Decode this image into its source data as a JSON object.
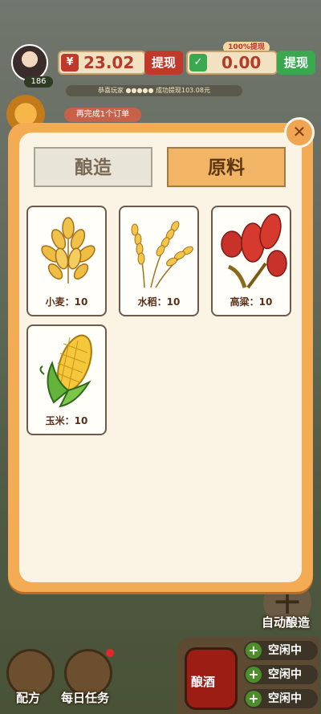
{
  "player": {
    "level": "186"
  },
  "currency": {
    "cash": {
      "amount": "23.02",
      "withdraw_label": "提现",
      "icon": "yuan-icon",
      "color": "#c0392b"
    },
    "wallet": {
      "amount": "0.00",
      "withdraw_label": "提现",
      "icon": "wechat-icon",
      "color": "#3aa84f",
      "badge": "100%提现"
    }
  },
  "ticker_text": "恭喜玩家 ●●●●● 成功提现103.08元",
  "order_chip": "再完成1个订单",
  "modal": {
    "tabs": [
      {
        "label": "酿造",
        "active": false
      },
      {
        "label": "原料",
        "active": true
      }
    ],
    "materials": [
      {
        "name": "小麦",
        "qty": "10",
        "label": "小麦：10",
        "icon": "wheat-icon"
      },
      {
        "name": "水稻",
        "qty": "10",
        "label": "水稻：10",
        "icon": "rice-icon"
      },
      {
        "name": "高粱",
        "qty": "10",
        "label": "高粱：10",
        "icon": "sorghum-icon"
      },
      {
        "name": "玉米",
        "qty": "10",
        "label": "玉米：10",
        "icon": "corn-icon"
      }
    ]
  },
  "bottom": {
    "recipe_label": "配方",
    "daily_task_label": "每日任务",
    "auto_brew_label": "自动酿造",
    "brew_jar_label": "酿酒",
    "slots": [
      {
        "label": "空闲中"
      },
      {
        "label": "空闲中"
      },
      {
        "label": "空闲中"
      }
    ]
  }
}
